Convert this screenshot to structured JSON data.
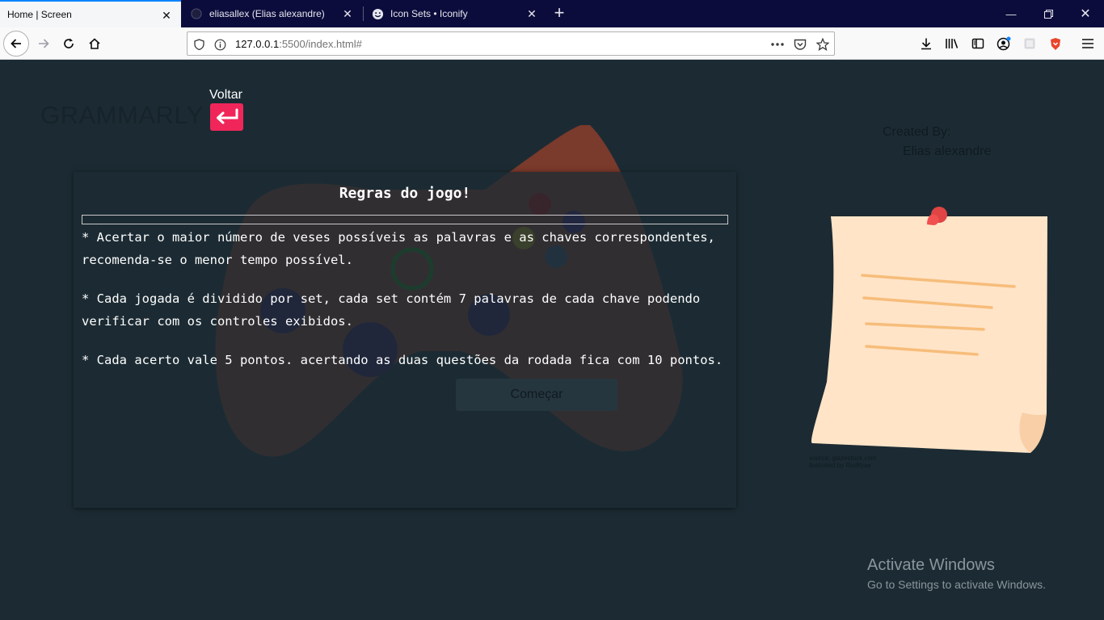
{
  "browser": {
    "tabs": [
      {
        "title": "Home | Screen",
        "active": true
      },
      {
        "title": "eliasallex (Elias alexandre)",
        "active": false
      },
      {
        "title": "Icon Sets • Iconify",
        "active": false
      }
    ],
    "url": {
      "host": "127.0.0.1",
      "rest": ":5500/index.html#"
    }
  },
  "page": {
    "logo": "GRAMMARLY",
    "back": {
      "label": "Voltar"
    },
    "rules": {
      "title": "Regras do jogo!",
      "items": [
        "* Acertar o maior número de veses possíveis as palavras e as chaves correspondentes, recomenda-se o menor tempo possível.",
        "* Cada jogada é dividido por set, cada set contém 7 palavras de cada chave podendo verificar com os controles exibidos.",
        "* Cada acerto vale 5 pontos. acertando as duas questões da rodada fica com 10 pontos."
      ],
      "start_label": "Começar"
    },
    "credits": {
      "created_by": "Created By:",
      "author": "Elias alexandre"
    },
    "image_credit": {
      "line1": "source: glazestock.com",
      "line2": "llustrated by Rudityas"
    }
  },
  "os": {
    "activate_title": "Activate Windows",
    "activate_sub": "Go to Settings to activate Windows."
  },
  "colors": {
    "page_bg": "#1c2b33",
    "accent": "#f0265a",
    "browser_tabbar": "#0c0c3c"
  }
}
